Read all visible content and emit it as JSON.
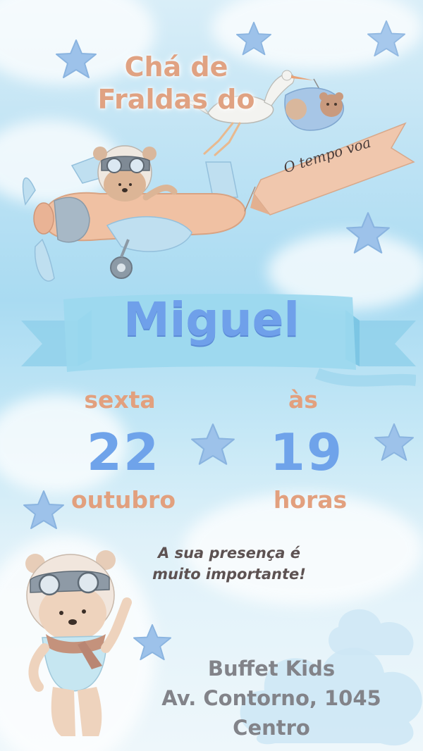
{
  "invitation": {
    "title_line1": "Chá de",
    "title_line2": "Fraldas do",
    "banner_text": "O tempo voa",
    "name": "Miguel",
    "day_of_week": "sexta",
    "day_number": "22",
    "month": "outubro",
    "time_prefix": "às",
    "hour_number": "19",
    "hour_label": "horas",
    "message_line1": "A sua presença é",
    "message_line2": "muito importante!",
    "venue_line1": "Buffet Kids",
    "venue_line2": "Av. Contorno, 1045",
    "venue_line3": "Centro"
  },
  "colors": {
    "peach": "#dc9b7c",
    "blue": "#6fa0ea",
    "gray": "#828389",
    "sky": "#a9dbf2"
  },
  "icons": [
    "star-icon",
    "airplane-icon",
    "bear-icon",
    "stork-icon",
    "cloud-icon",
    "ribbon-icon"
  ]
}
